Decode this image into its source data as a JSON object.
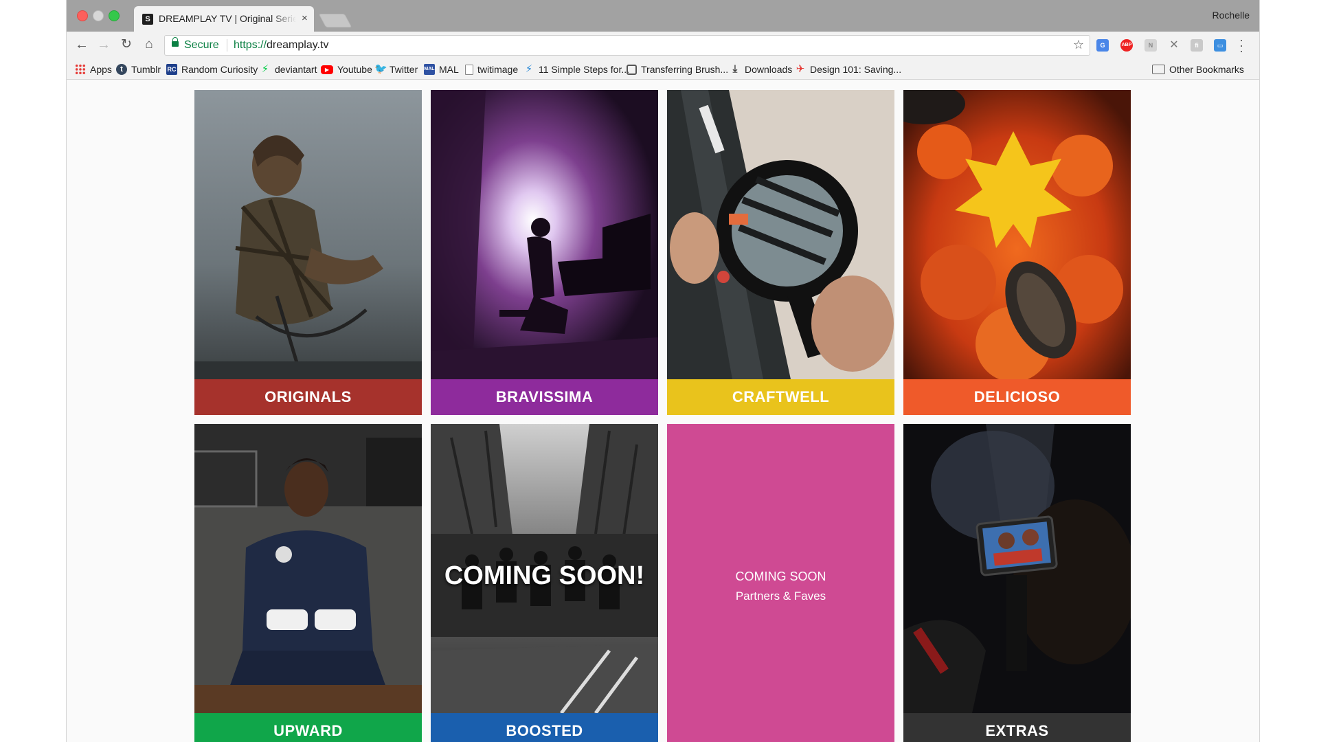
{
  "browser": {
    "tab": {
      "title": "DREAMPLAY TV | Original Series"
    },
    "profile": "Rochelle",
    "omnibox": {
      "secure_label": "Secure",
      "url_scheme": "https://",
      "url_host": "dreamplay.tv"
    },
    "bookmarks": [
      {
        "label": "Apps",
        "icon": "apps-grid-icon"
      },
      {
        "label": "Tumblr",
        "icon": "tumblr-icon"
      },
      {
        "label": "Random Curiosity",
        "icon": "random-curiosity-icon"
      },
      {
        "label": "deviantart",
        "icon": "deviantart-icon"
      },
      {
        "label": "Youtube",
        "icon": "youtube-icon"
      },
      {
        "label": "Twitter",
        "icon": "twitter-icon"
      },
      {
        "label": "MAL",
        "icon": "mal-icon"
      },
      {
        "label": "twitimage",
        "icon": "document-icon"
      },
      {
        "label": "11 Simple Steps for...",
        "icon": "bolt-icon"
      },
      {
        "label": "Transferring Brush...",
        "icon": "brush-icon"
      },
      {
        "label": "Downloads",
        "icon": "download-icon"
      },
      {
        "label": "Design 101: Saving...",
        "icon": "design-icon"
      }
    ],
    "other_bookmarks": "Other Bookmarks"
  },
  "tiles": [
    {
      "name": "originals",
      "label": "ORIGINALS",
      "color": "#a6322c",
      "photo": "bearded man with dreadlocks on a bike"
    },
    {
      "name": "bravissima",
      "label": "BRAVISSIMA",
      "color": "#8e2b9c",
      "photo": "pianist silhouette on stage"
    },
    {
      "name": "craftwell",
      "label": "CRAFTWELL",
      "color": "#e9c31c",
      "photo": "magnifying glass over sewing machine"
    },
    {
      "name": "delicioso",
      "label": "DELICIOSO",
      "color": "#ef5a2a",
      "photo": "seafood paella"
    },
    {
      "name": "upward",
      "label": "UPWARD",
      "color": "#10a64a",
      "photo": "young boxer with wrapped hands"
    },
    {
      "name": "boosted",
      "label": "BOOSTED",
      "color": "#1a5fae",
      "photo": "runners in a marathon",
      "overlay": "COMING SOON!"
    },
    {
      "name": "partners-faves",
      "coming_soon": "COMING SOON",
      "subtitle": "Partners & Faves",
      "color": "#cf4a93"
    },
    {
      "name": "extras",
      "label": "EXTRAS",
      "color": "#333333",
      "photo": "camera operator filming"
    }
  ]
}
